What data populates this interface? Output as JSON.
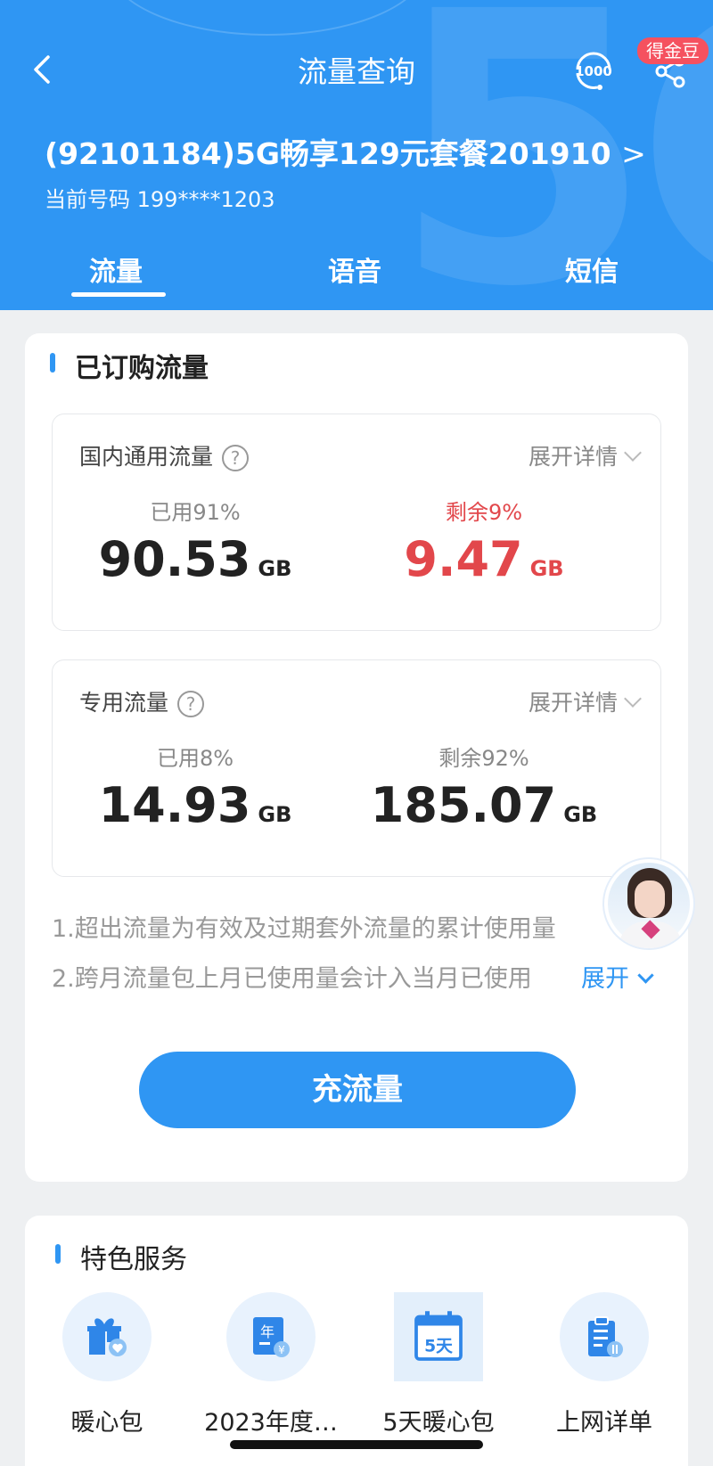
{
  "header": {
    "title": "流量查询",
    "badge": "得金豆",
    "icon_1000_label": "1000",
    "plan_name": "(92101184)5G畅享129元套餐201910",
    "phone_label": "当前号码",
    "phone_number": "199****1203",
    "tabs": [
      "流量",
      "语音",
      "短信"
    ],
    "active_tab": 0
  },
  "subscribed": {
    "section_title": "已订购流量",
    "general": {
      "label": "国内通用流量",
      "expand": "展开详情",
      "used_label": "已用91%",
      "used_value": "90.53",
      "remain_label": "剩余9%",
      "remain_value": "9.47",
      "unit": "GB"
    },
    "special": {
      "label": "专用流量",
      "expand": "展开详情",
      "used_label": "已用8%",
      "used_value": "14.93",
      "remain_label": "剩余92%",
      "remain_value": "185.07",
      "unit": "GB"
    },
    "notes": [
      "1.超出流量为有效及过期套外流量的累计使用量",
      "2.跨月流量包上月已使用量会计入当月已使用"
    ],
    "notes_expand": "展开",
    "recharge_button": "充流量"
  },
  "services": {
    "section_title": "特色服务",
    "items": [
      {
        "label": "暖心包",
        "icon": "gift-heart-icon"
      },
      {
        "label": "2023年度…",
        "icon": "year-report-icon",
        "icon_text": "年"
      },
      {
        "label": "5天暖心包",
        "icon": "calendar-5-days-icon",
        "icon_text": "5天"
      },
      {
        "label": "上网详单",
        "icon": "clipboard-bill-icon"
      }
    ]
  },
  "colors": {
    "primary": "#2f96f3",
    "alert": "#e2474b",
    "badge": "#f5515f"
  }
}
